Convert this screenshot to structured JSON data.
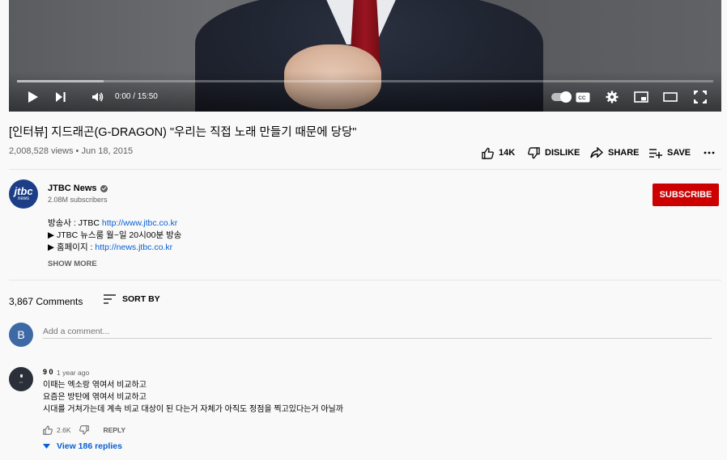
{
  "player": {
    "time_display": "0:00 / 15:50",
    "progress_loaded_fraction": 0.124,
    "icons": [
      "play-icon",
      "next-icon",
      "volume-icon",
      "autoplay-toggle",
      "captions-icon",
      "settings-icon",
      "miniplayer-icon",
      "theater-icon",
      "fullscreen-icon"
    ]
  },
  "video": {
    "title": "[인터뷰] 지드래곤(G-DRAGON) \"우리는 직접 노래 만들기 때문에 당당\"",
    "meta": "2,008,528 views • Jun 18, 2015",
    "actions": {
      "like": "14K",
      "dislike": "DISLIKE",
      "share": "SHARE",
      "save": "SAVE",
      "more": "..."
    }
  },
  "channel": {
    "avatar_line1": "jtbc",
    "avatar_line2": "news",
    "name": "JTBC News",
    "subscribers": "2.08M subscribers",
    "subscribe_label": "SUBSCRIBE"
  },
  "description": {
    "line1_text": "방송사 : JTBC ",
    "line1_link": "http://www.jtbc.co.kr",
    "line2_text": "▶ JTBC 뉴스룸 월~일 20시00분 방송",
    "line3_text": "▶ 홈페이지 : ",
    "line3_link": "http://news.jtbc.co.kr",
    "show_more": "SHOW MORE"
  },
  "comments": {
    "count": "3,867 Comments",
    "sort_label": "SORT BY",
    "user_initial": "B",
    "add_placeholder": "Add a comment...",
    "items": [
      {
        "author": "9 0",
        "time": "1 year ago",
        "lines": [
          "이때는 엑소랑 엮여서 비교하고",
          "요즘은 방탄에 엮여서 비교하고",
          "시대를 거쳐가는데 계속 비교 대상이 된 다는거 자체가 아직도 정점을 찍고있다는거 아닐까"
        ],
        "likes": "2.6K",
        "reply_label": "REPLY",
        "view_replies": "View 186 replies"
      }
    ]
  }
}
